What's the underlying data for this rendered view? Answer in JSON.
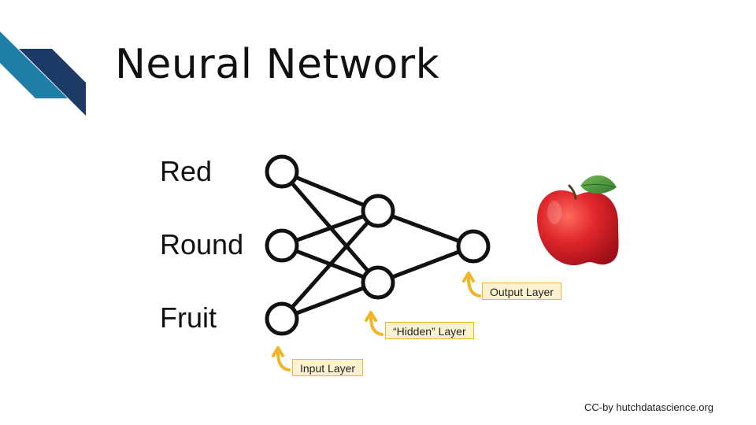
{
  "title": "Neural Network",
  "input_labels": [
    "Red",
    "Round",
    "Fruit"
  ],
  "callouts": {
    "output": "Output Layer",
    "hidden": "“Hidden” Layer",
    "input": "Input Layer"
  },
  "credit": "CC-by hutchdatascience.org",
  "colors": {
    "accent_dark_blue": "#1b3a66",
    "accent_teal": "#1e7fa6",
    "arrow_orange": "#f0b626",
    "callout_fill": "#fdf1cf",
    "apple_red": "#d8222a",
    "leaf_green": "#4d9a3c"
  },
  "icons": [
    "apple-image",
    "curved-arrow-icon"
  ]
}
